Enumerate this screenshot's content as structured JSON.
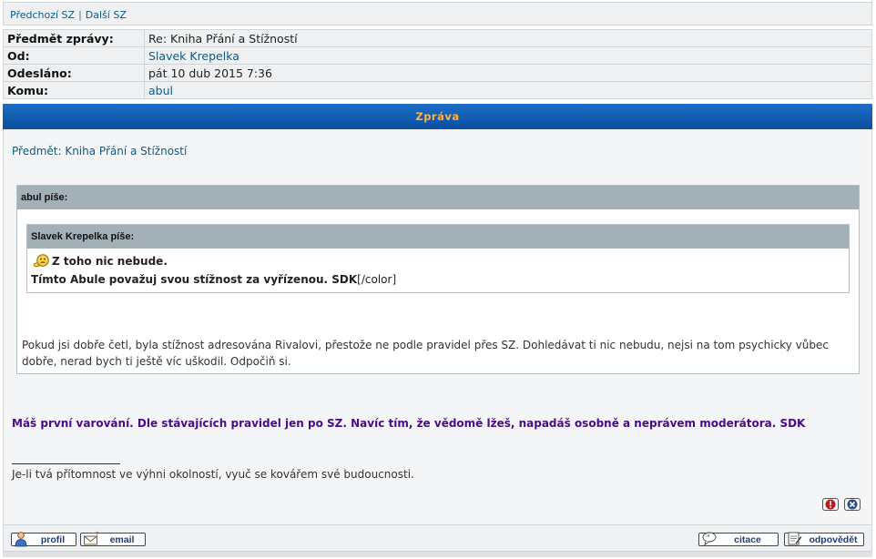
{
  "nav": {
    "prev": "Předchozí SZ",
    "separator": "|",
    "next": "Další SZ"
  },
  "header": {
    "rows": [
      {
        "label": "Předmět zprávy:",
        "value": "Re: Kniha Přání a Stížností"
      },
      {
        "label": "Od:",
        "value": "Slavek Krepelka"
      },
      {
        "label": "Odesláno:",
        "value": "pát 10 dub 2015 7:36"
      },
      {
        "label": "Komu:",
        "value": "abul"
      }
    ]
  },
  "section_title": "Zpráva",
  "message": {
    "subject": "Předmět: Kniha Přání a Stížností",
    "outer_quote": {
      "author": "abul píše:",
      "inner_quote": {
        "author": "Slavek Krepelka píše:",
        "line1": "Z toho nic nebude.",
        "line2_bold": "Tímto Abule považuj svou stížnost za vyřízenou. SDK",
        "line2_tail": "[/color]"
      },
      "text": "Pokud jsi dobře četl, byla stížnost adresována Rivalovi, přestože ne podle pravidel přes SZ. Dohledávat ti nic nebudu, nejsi na tom psychicky vůbec dobře, nerad bych ti ještě víc uškodil. Odpočiň si."
    },
    "warning": "Máš první varování. Dle stávajících pravidel jen po SZ. Navíc tím, že vědomě lžeš, napadáš osobně a neprávem moderátora. SDK",
    "signature": "Je-li tvá přítomnost ve výhni okolností, vyuč se kovářem své budoucnosti."
  },
  "icons": {
    "report": "report-icon",
    "delete": "delete-icon"
  },
  "footer": {
    "profile_label": "profil",
    "email_label": "email",
    "quote_label": "citace",
    "reply_label": "odpovědět"
  },
  "colors": {
    "bar": "#0a4e9e",
    "bar_text": "#ffb04a",
    "warning": "#4b0a8a",
    "link": "#0a5c8c"
  }
}
